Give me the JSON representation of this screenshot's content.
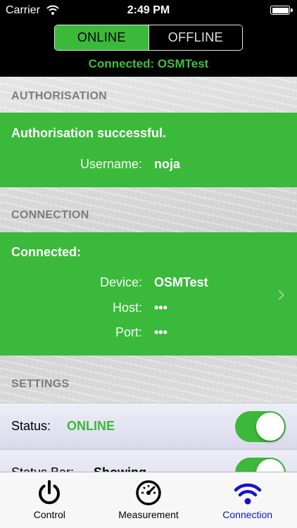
{
  "status_bar": {
    "carrier": "Carrier",
    "time": "2:49 PM"
  },
  "segmented_control": {
    "online_label": "ONLINE",
    "offline_label": "OFFLINE",
    "selected": "ONLINE"
  },
  "connection_status": "Connected: OSMTest",
  "authorisation": {
    "header": "AUTHORISATION",
    "title": "Authorisation successful.",
    "username_label": "Username:",
    "username_value": "noja"
  },
  "connection": {
    "header": "CONNECTION",
    "title": "Connected:",
    "device_label": "Device:",
    "device_value": "OSMTest",
    "host_label": "Host:",
    "host_value": "•••",
    "port_label": "Port:",
    "port_value": "•••"
  },
  "settings": {
    "header": "SETTINGS",
    "status_label": "Status:",
    "status_value": "ONLINE",
    "status_toggle_on": true,
    "status_bar_label": "Status Bar:",
    "status_bar_value": "Showing",
    "status_bar_toggle_on": true
  },
  "tabs": [
    {
      "label": "Control",
      "icon": "power-icon",
      "selected": false
    },
    {
      "label": "Measurement",
      "icon": "gauge-icon",
      "selected": false
    },
    {
      "label": "Connection",
      "icon": "wifi-icon",
      "selected": true
    }
  ],
  "colors": {
    "accent_green": "#3ab93a",
    "connected_text_green": "#3bc23b",
    "selected_tab_blue": "#1414c8"
  }
}
